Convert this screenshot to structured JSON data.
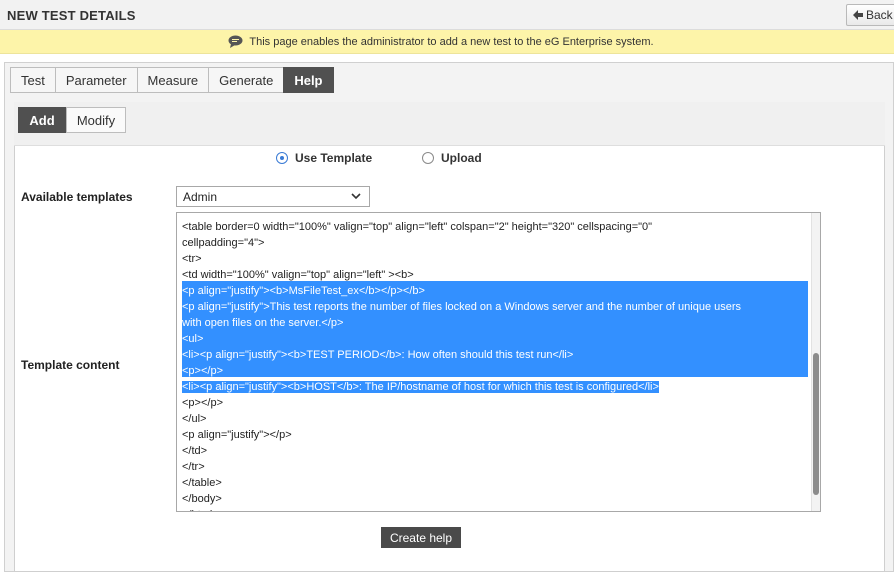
{
  "header": {
    "title": "NEW TEST DETAILS",
    "back_label": "Back"
  },
  "info": {
    "message": "This page enables the administrator to add a new test to the eG Enterprise system."
  },
  "tabs": [
    {
      "label": "Test"
    },
    {
      "label": "Parameter"
    },
    {
      "label": "Measure"
    },
    {
      "label": "Generate"
    },
    {
      "label": "Help"
    }
  ],
  "active_tab": "Help",
  "subtabs": {
    "add": "Add",
    "modify": "Modify"
  },
  "source": {
    "use_template": "Use Template",
    "upload": "Upload",
    "selected": "Use Template"
  },
  "templates": {
    "label": "Available templates",
    "selected": "Admin"
  },
  "content": {
    "label": "Template content",
    "lines": [
      {
        "text": "<table border=0 width=\"100%\" valign=\"top\" align=\"left\" colspan=\"2\" height=\"320\" cellspacing=\"0\"",
        "selected": false
      },
      {
        "text": "cellpadding=\"4\">",
        "selected": false
      },
      {
        "text": "<tr>",
        "selected": false
      },
      {
        "text": "<td width=\"100%\" valign=\"top\" align=\"left\" ><b>",
        "selected": false
      },
      {
        "text": "<p align=\"justify\"><b>MsFileTest_ex</b></p></b>",
        "selected": true
      },
      {
        "text": "<p align=\"justify\">This test reports the number of files locked on a Windows server and the number of unique users",
        "selected": true
      },
      {
        "text": "with open files on the server.</p>",
        "selected": true
      },
      {
        "text": "<ul>",
        "selected": true
      },
      {
        "text": "<li><p align=\"justify\"><b>TEST PERIOD</b>: How often should this test run</li>",
        "selected": true
      },
      {
        "text": "<p></p>",
        "selected": true
      },
      {
        "text": "<li><p align=\"justify\"><b>HOST</b>: The IP/hostname of host for which this test is configured</li>",
        "selected": true
      },
      {
        "text": "<p></p>",
        "selected": false
      },
      {
        "text": "</ul>",
        "selected": false
      },
      {
        "text": "<p align=\"justify\"></p>",
        "selected": false
      },
      {
        "text": "</td>",
        "selected": false
      },
      {
        "text": "</tr>",
        "selected": false
      },
      {
        "text": "</table>",
        "selected": false
      },
      {
        "text": "</body>",
        "selected": false
      },
      {
        "text": "</html>",
        "selected": false
      }
    ]
  },
  "actions": {
    "create": "Create help"
  },
  "colors": {
    "active_tab": "#505050",
    "info_bar": "#fdf4a9",
    "selection": "#3390ff"
  }
}
